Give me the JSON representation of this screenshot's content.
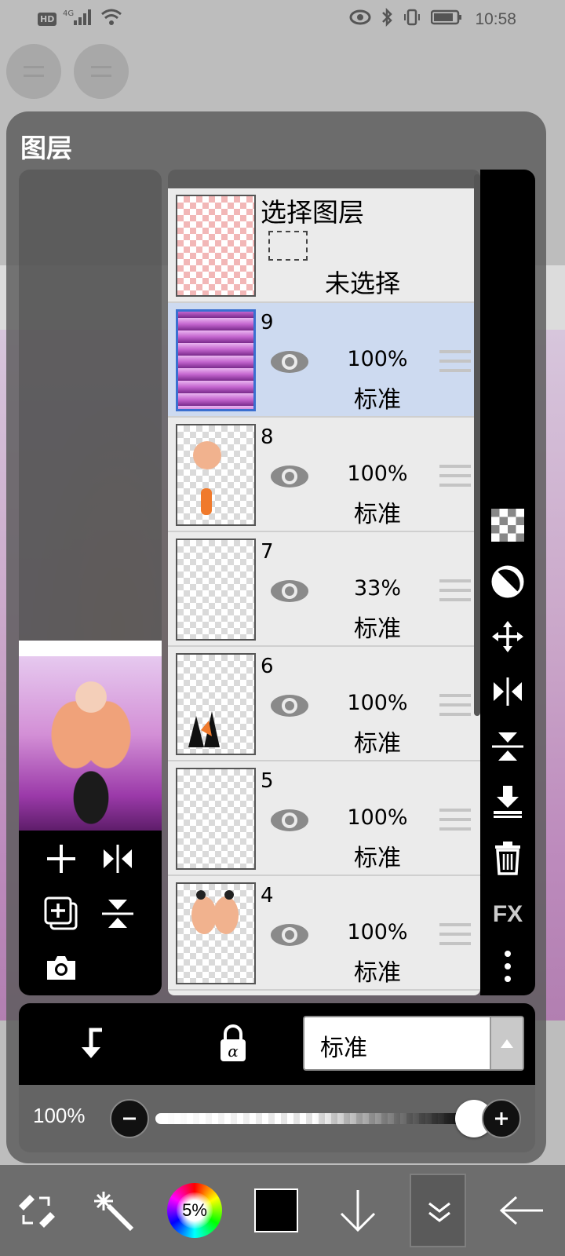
{
  "status_bar": {
    "left_badge": "HD",
    "signal_label": "4G",
    "time": "10:58"
  },
  "panel": {
    "title": "图层"
  },
  "selection_layer": {
    "title": "选择图层",
    "status": "未选择"
  },
  "layers": [
    {
      "number": "9",
      "opacity": "100%",
      "blend": "标准",
      "selected": true
    },
    {
      "number": "8",
      "opacity": "100%",
      "blend": "标准",
      "selected": false
    },
    {
      "number": "7",
      "opacity": "33%",
      "blend": "标准",
      "selected": false
    },
    {
      "number": "6",
      "opacity": "100%",
      "blend": "标准",
      "selected": false
    },
    {
      "number": "5",
      "opacity": "100%",
      "blend": "标准",
      "selected": false
    },
    {
      "number": "4",
      "opacity": "100%",
      "blend": "标准",
      "selected": false
    }
  ],
  "right_toolbar": {
    "fx_label": "FX"
  },
  "blend_mode": {
    "selected": "标准"
  },
  "opacity_control": {
    "label": "100%",
    "value_fraction": 1.0
  },
  "bottom_toolbar": {
    "brush_size_label": "5%",
    "current_color": "#000000"
  },
  "colors": {
    "selected_row": "#cddaf0",
    "selected_border": "#3a6fd0",
    "panel_bg": "#5a5a5a",
    "toolbar_bg": "#000000"
  }
}
